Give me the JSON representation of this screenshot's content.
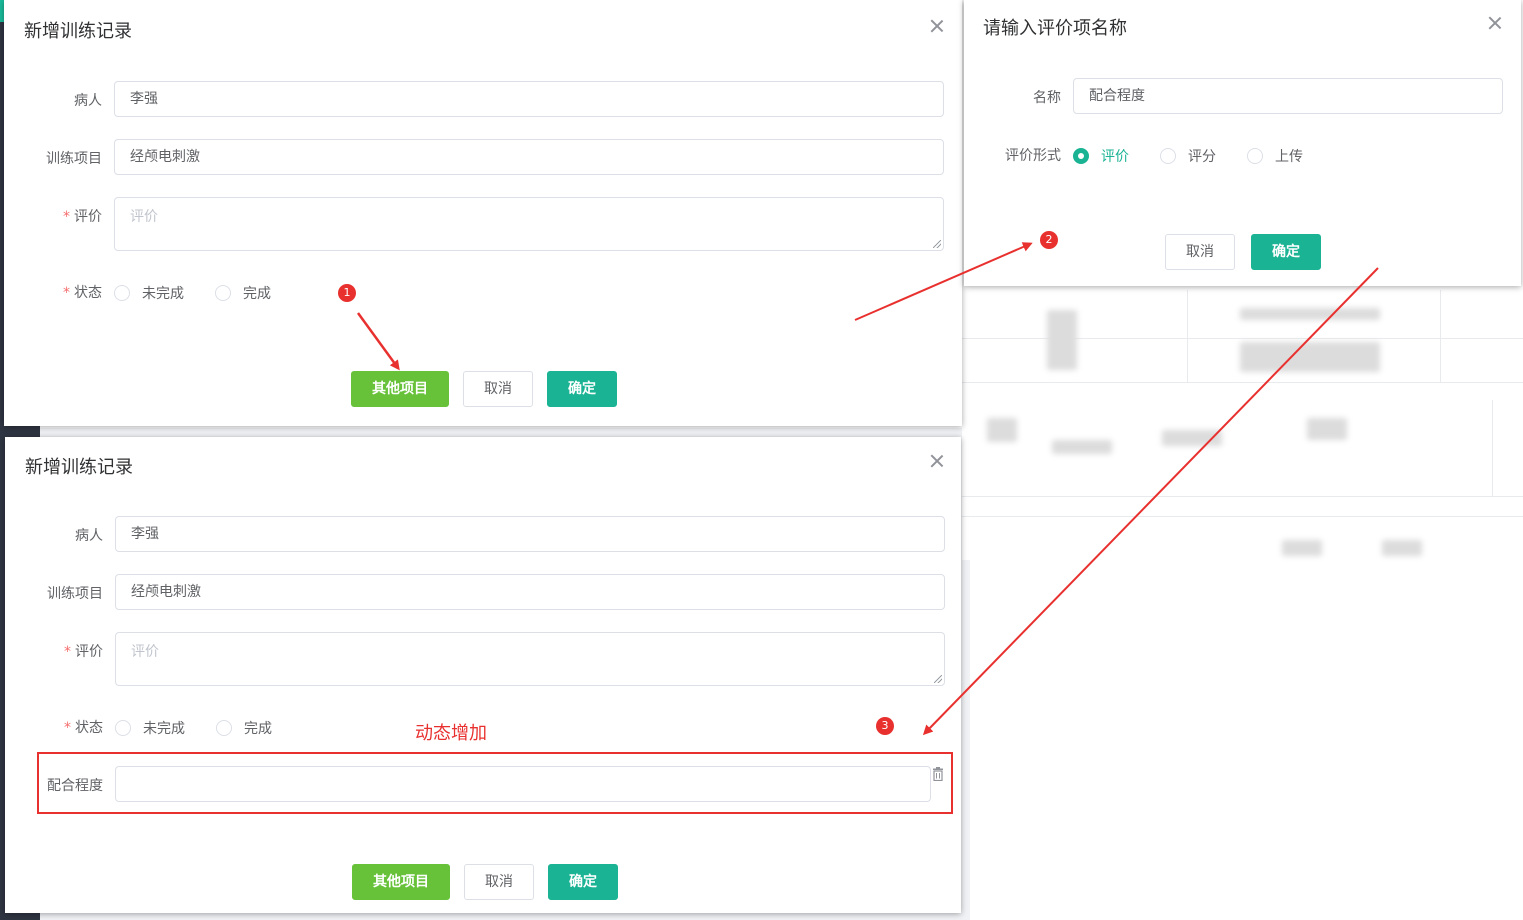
{
  "dialog1": {
    "title": "新增训练记录",
    "patient_label": "病人",
    "patient_value": "李强",
    "project_label": "训练项目",
    "project_value": "经颅电刺激",
    "eval_label": "评价",
    "eval_placeholder": "评价",
    "status_label": "状态",
    "status_options": [
      "未完成",
      "完成"
    ],
    "btn_other": "其他项目",
    "btn_cancel": "取消",
    "btn_ok": "确定"
  },
  "dialog2": {
    "title": "请输入评价项名称",
    "name_label": "名称",
    "name_value": "配合程度",
    "form_label": "评价形式",
    "form_options": [
      "评价",
      "评分",
      "上传"
    ],
    "form_selected": "评价",
    "btn_cancel": "取消",
    "btn_ok": "确定"
  },
  "dialog3": {
    "title": "新增训练记录",
    "patient_label": "病人",
    "patient_value": "李强",
    "project_label": "训练项目",
    "project_value": "经颅电刺激",
    "eval_label": "评价",
    "eval_placeholder": "评价",
    "status_label": "状态",
    "status_options": [
      "未完成",
      "完成"
    ],
    "dynamic_label": "配合程度",
    "dynamic_value": "",
    "btn_other": "其他项目",
    "btn_cancel": "取消",
    "btn_ok": "确定"
  },
  "annotations": {
    "step1": "1",
    "step2": "2",
    "step3": "3",
    "dynamic_text": "动态增加",
    "color": "#e8312f"
  },
  "colors": {
    "primary_teal": "#1ab394",
    "green": "#67c23a",
    "required": "#f56c6c"
  }
}
